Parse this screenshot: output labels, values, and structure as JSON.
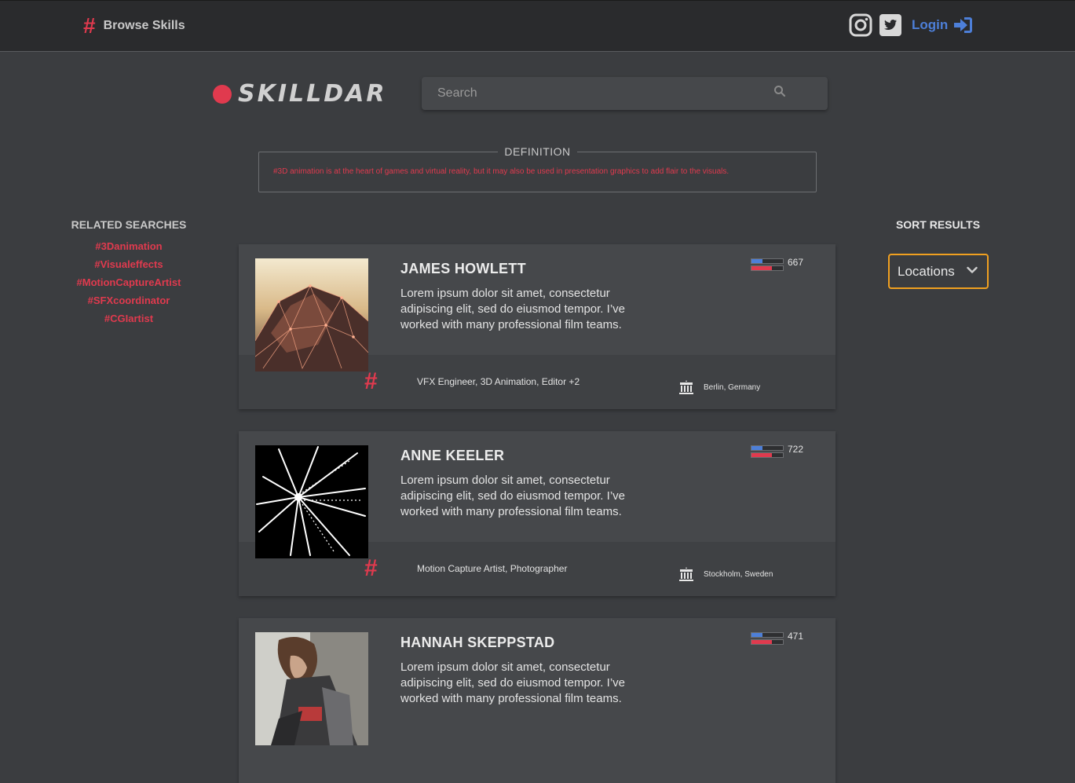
{
  "nav": {
    "browse_label": "Browse Skills",
    "hash_symbol": "#",
    "login_label": "Login",
    "icons": [
      "instagram-icon",
      "twitter-icon",
      "sign-in-icon"
    ]
  },
  "logo": {
    "text": "SKILLDAR"
  },
  "search": {
    "placeholder": "Search"
  },
  "definition": {
    "legend": "DEFINITION",
    "text": "#3D animation is at the heart of games and virtual reality, but it may also be used in presentation graphics to add flair to the visuals."
  },
  "related": {
    "title": "RELATED SEARCHES",
    "items": [
      "#3Danimation",
      "#Visualeffects",
      "#MotionCaptureArtist",
      "#SFXcoordinator",
      "#CGIartist"
    ]
  },
  "sort": {
    "title": "SORT RESULTS",
    "selected": "Locations"
  },
  "colors": {
    "accent": "#e03a4e",
    "login": "#4d7fd8",
    "sort_border": "#f0a020",
    "bar_blue": "#4d7fd8",
    "bar_red": "#e03a4e"
  },
  "cards": [
    {
      "name": "JAMES HOWLETT",
      "description": "Lorem ipsum dolor sit amet, consectetur adipiscing elit, sed do eiusmod tempor. I’ve worked with many professional film teams.",
      "score": "667",
      "blue_level": 0.35,
      "red_level": 0.65,
      "skills": "VFX Engineer, 3D Animation, Editor +2",
      "location": "Berlin, Germany",
      "hash": "#"
    },
    {
      "name": "ANNE KEELER",
      "description": "Lorem ipsum dolor sit amet, consectetur adipiscing elit, sed do eiusmod tempor. I’ve worked with many professional film teams.",
      "score": "722",
      "blue_level": 0.35,
      "red_level": 0.65,
      "skills": "Motion Capture Artist, Photographer",
      "location": "Stockholm, Sweden",
      "hash": "#"
    },
    {
      "name": "HANNAH SKEPPSTAD",
      "description": "Lorem ipsum dolor sit amet, consectetur adipiscing elit, sed do eiusmod tempor. I’ve worked with many professional film teams.",
      "score": "471",
      "blue_level": 0.35,
      "red_level": 0.65,
      "skills": "",
      "location": "",
      "hash": "#"
    }
  ]
}
